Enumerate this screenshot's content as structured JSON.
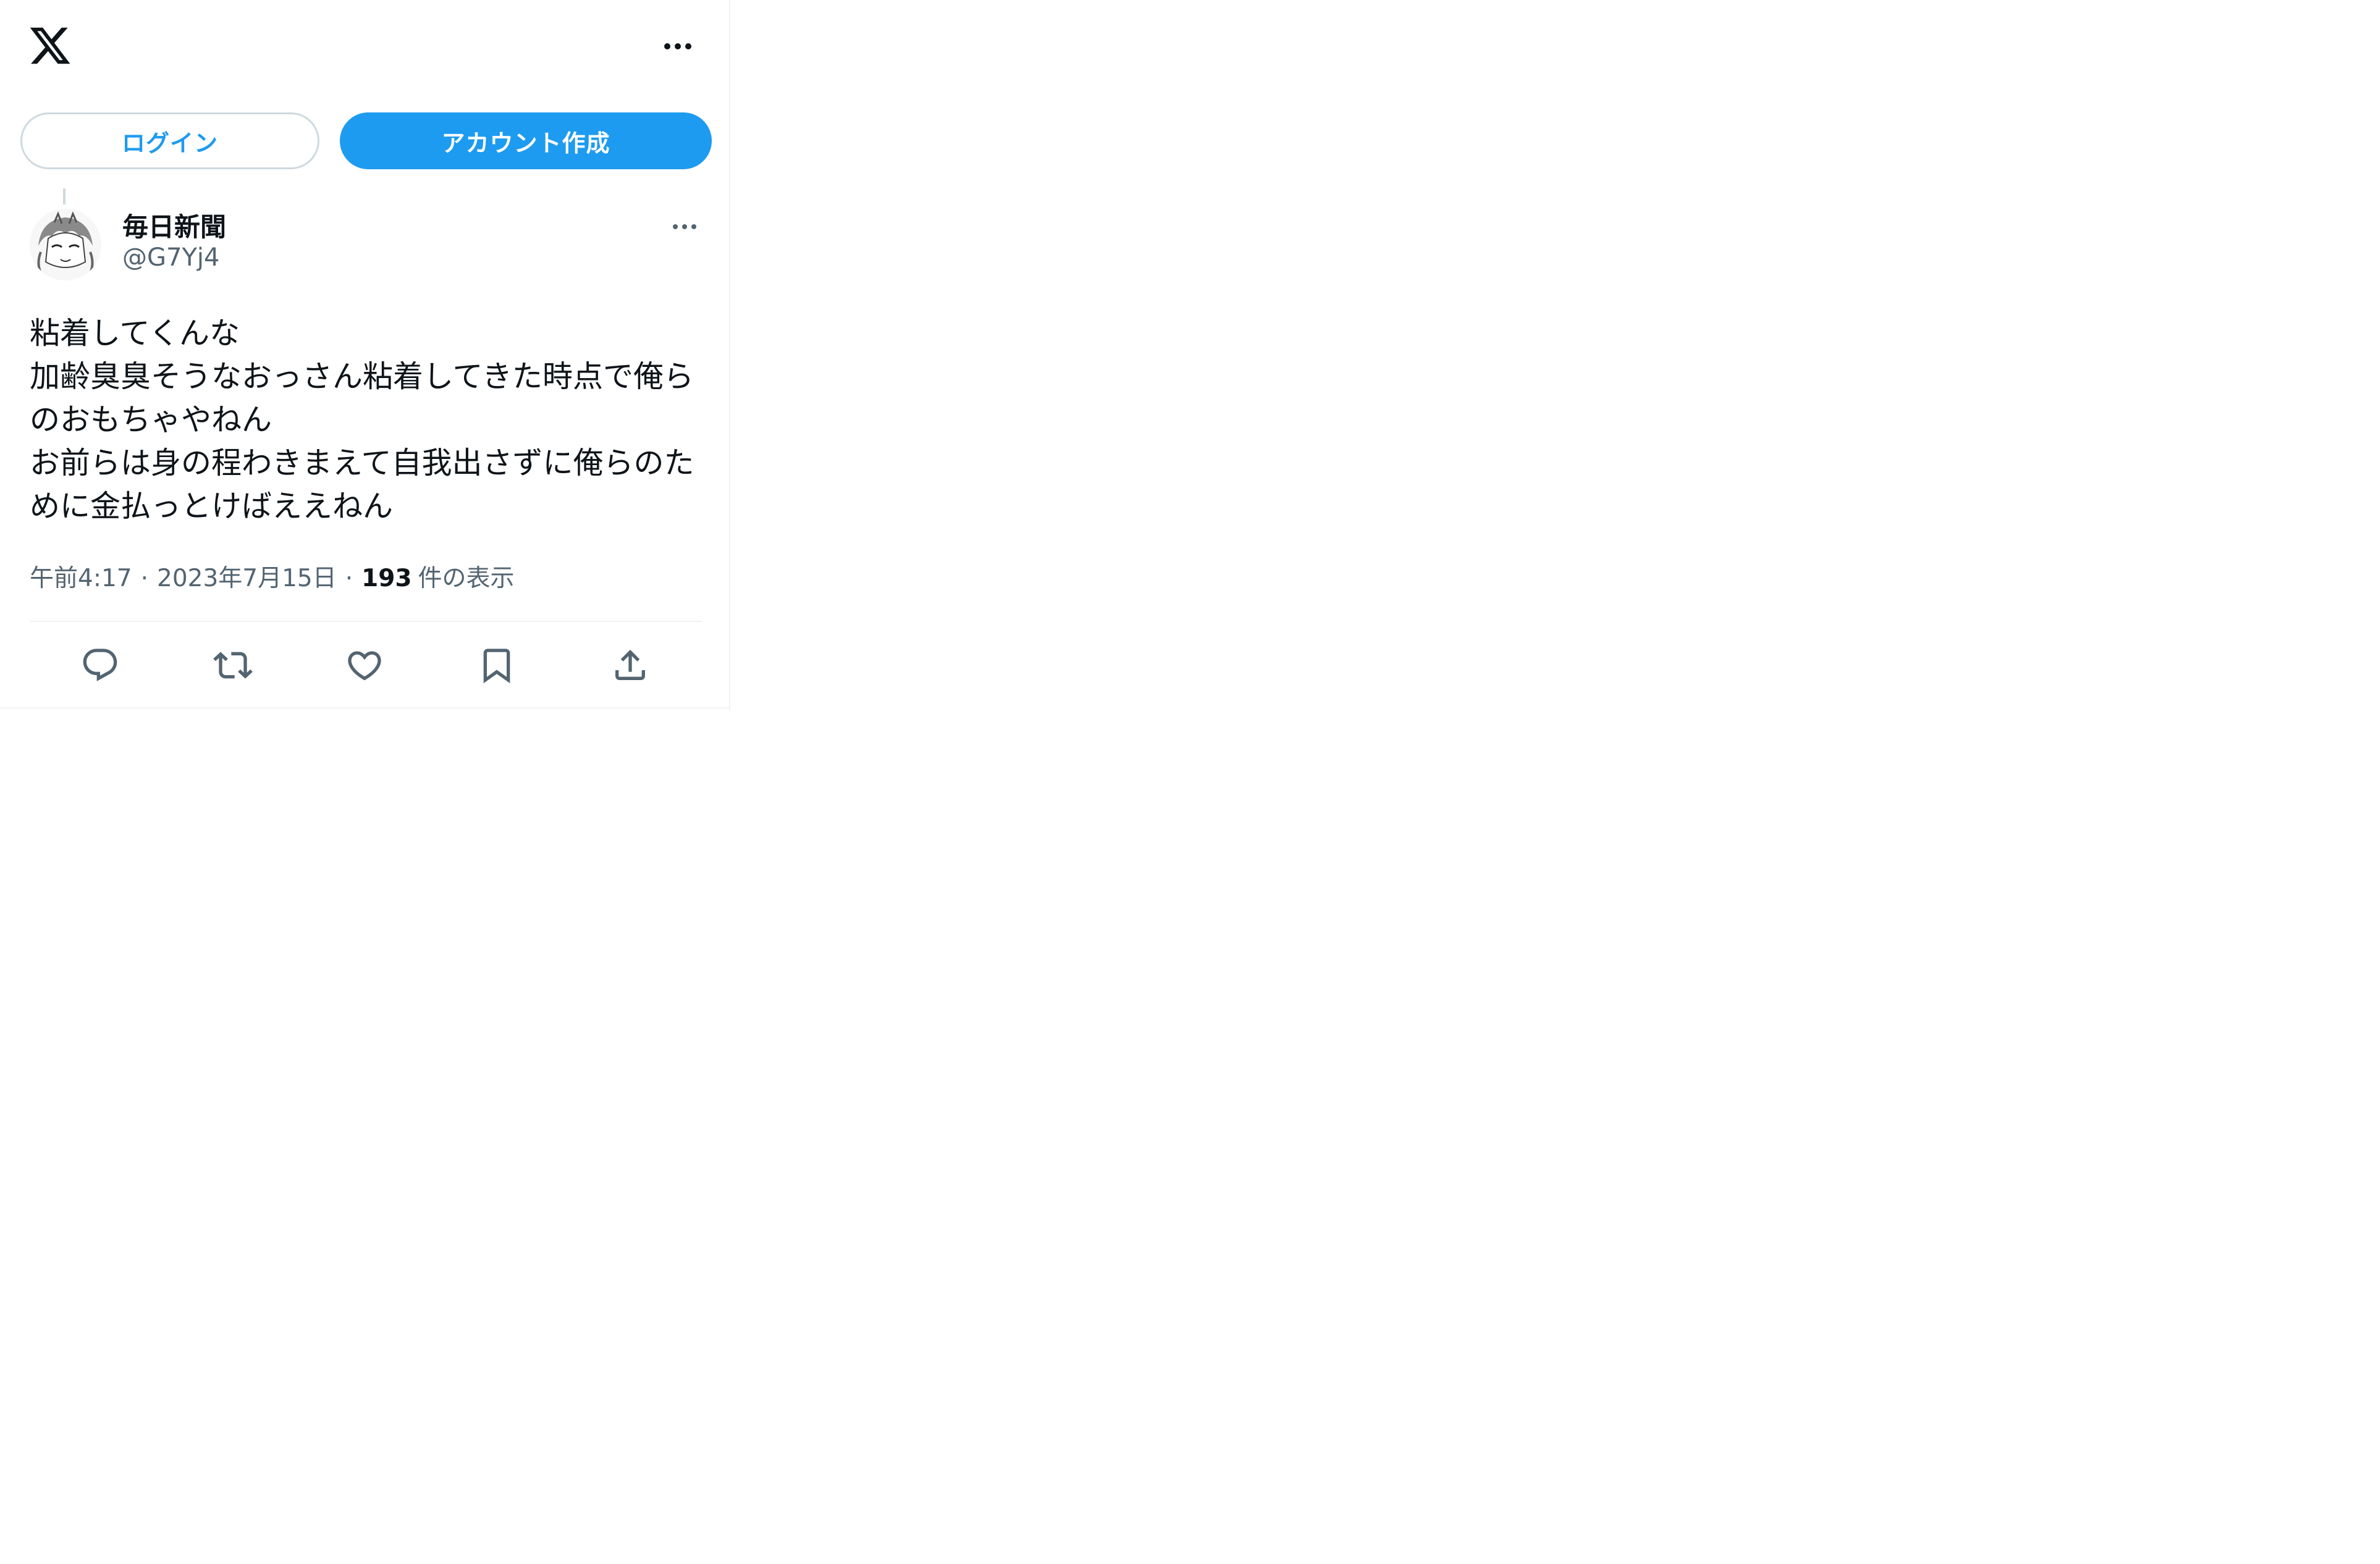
{
  "header": {
    "logo_icon": "x-logo-icon",
    "more_icon": "more-horizontal-icon"
  },
  "auth": {
    "login_label": "ログイン",
    "signup_label": "アカウント作成"
  },
  "post": {
    "display_name": "毎日新聞",
    "handle": "@G7Yj4",
    "text": "粘着してくんな\n加齢臭臭そうなおっさん粘着してきた時点で俺らのおもちゃやねん\nお前らは身の程わきまえて自我出さずに俺らのために金払っとけばええねん",
    "time": "午前4:17",
    "date": "2023年7月15日",
    "separator": "·",
    "views_count": "193",
    "views_label": "件の表示"
  },
  "actions": {
    "icons": [
      "reply-icon",
      "retweet-icon",
      "like-icon",
      "bookmark-icon",
      "share-icon"
    ]
  },
  "colors": {
    "accent": "#1d9bf0",
    "text": "#0f1419",
    "muted": "#536471",
    "border": "#cfd9de"
  }
}
